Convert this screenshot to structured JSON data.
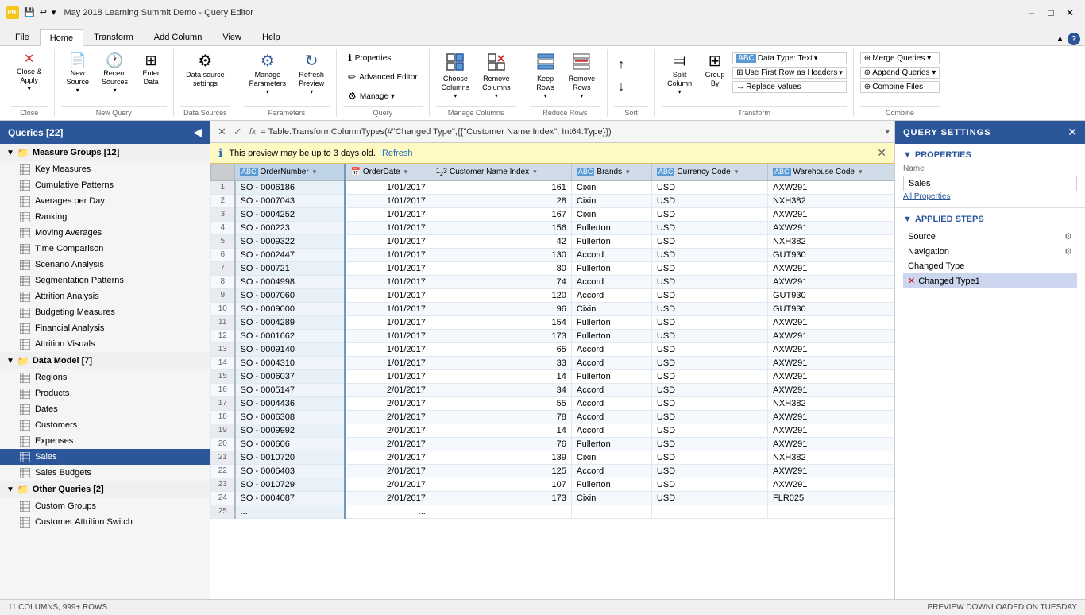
{
  "titleBar": {
    "icon": "PBI",
    "title": "May 2018 Learning Summit Demo - Query Editor",
    "minBtn": "–",
    "maxBtn": "□",
    "closeBtn": "✕"
  },
  "ribbonTabs": [
    "File",
    "Home",
    "Transform",
    "Add Column",
    "View",
    "Help"
  ],
  "activeTab": "Home",
  "ribbonGroups": {
    "close": {
      "label": "Close",
      "buttons": [
        {
          "label": "Close &\nApply",
          "icon": "✕"
        }
      ]
    },
    "newQuery": {
      "label": "New Query",
      "buttons": [
        {
          "label": "New\nSource",
          "icon": "📄"
        },
        {
          "label": "Recent\nSources",
          "icon": "🕐"
        },
        {
          "label": "Enter\nData",
          "icon": "⌨"
        }
      ]
    },
    "dataSources": {
      "label": "Data Sources",
      "buttons": [
        {
          "label": "Data source\nsettings",
          "icon": "⚙"
        }
      ]
    },
    "parameters": {
      "label": "Parameters",
      "buttons": [
        {
          "label": "Manage\nParameters",
          "icon": "⚙"
        },
        {
          "label": "Refresh\nPreview",
          "icon": "↻"
        }
      ]
    },
    "query": {
      "label": "Query",
      "buttons": [
        {
          "label": "Properties",
          "icon": "ℹ"
        },
        {
          "label": "Advanced Editor",
          "icon": "✏"
        },
        {
          "label": "Manage ▾",
          "icon": "⚙"
        }
      ]
    },
    "manageColumns": {
      "label": "Manage Columns",
      "buttons": [
        {
          "label": "Choose\nColumns",
          "icon": "⊞"
        },
        {
          "label": "Remove\nColumns",
          "icon": "⊟"
        }
      ]
    },
    "reduceRows": {
      "label": "Reduce Rows",
      "buttons": [
        {
          "label": "Keep\nRows",
          "icon": "⊡"
        },
        {
          "label": "Remove\nRows",
          "icon": "⊠"
        }
      ]
    },
    "sort": {
      "label": "Sort",
      "buttons": [
        {
          "label": "↑",
          "icon": "↑"
        },
        {
          "label": "↓",
          "icon": "↓"
        }
      ]
    },
    "transform": {
      "label": "Transform",
      "rows": [
        {
          "label": "Data Type: Text ▾",
          "icon": "ABC"
        },
        {
          "label": "Use First Row as Headers ▾",
          "icon": "⊞"
        },
        {
          "label": "Replace Values",
          "icon": "↔"
        }
      ],
      "buttons": [
        {
          "label": "Split\nColumn",
          "icon": "⫤"
        },
        {
          "label": "Group\nBy",
          "icon": "⊞"
        }
      ]
    },
    "combine": {
      "label": "Combine",
      "buttons": [
        {
          "label": "Merge Queries ▾",
          "icon": "⊕"
        },
        {
          "label": "Append Queries ▾",
          "icon": "⊕"
        },
        {
          "label": "Combine Files",
          "icon": "⊕"
        }
      ]
    }
  },
  "sidebar": {
    "title": "Queries [22]",
    "groups": [
      {
        "name": "Measure Groups [12]",
        "expanded": true,
        "items": [
          "Key Measures",
          "Cumulative Patterns",
          "Averages per Day",
          "Ranking",
          "Moving Averages",
          "Time Comparison",
          "Scenario Analysis",
          "Segmentation Patterns",
          "Attrition Analysis",
          "Budgeting Measures",
          "Financial Analysis",
          "Attrition Visuals"
        ]
      },
      {
        "name": "Data Model [7]",
        "expanded": true,
        "items": [
          "Regions",
          "Products",
          "Dates",
          "Customers",
          "Expenses",
          "Sales",
          "Sales Budgets"
        ]
      },
      {
        "name": "Other Queries [2]",
        "expanded": true,
        "items": [
          "Custom Groups",
          "Customer Attrition Switch"
        ]
      }
    ],
    "activeItem": "Sales"
  },
  "notification": {
    "icon": "ℹ",
    "text": "This preview may be up to 3 days old.",
    "refreshLabel": "Refresh"
  },
  "formulaBar": {
    "formula": "= Table.TransformColumnTypes(#\"Changed Type\",{{\"Customer Name Index\", Int64.Type}})"
  },
  "table": {
    "columns": [
      {
        "name": "OrderNumber",
        "type": "ABC",
        "isKey": true
      },
      {
        "name": "OrderDate",
        "type": "📅"
      },
      {
        "name": "Customer Name Index",
        "type": "123"
      },
      {
        "name": "Brands",
        "type": "ABC"
      },
      {
        "name": "Currency Code",
        "type": "ABC"
      },
      {
        "name": "Warehouse Code",
        "type": "ABC"
      }
    ],
    "rows": [
      [
        1,
        "SO - 0006186",
        "1/01/2017",
        161,
        "Cixin",
        "USD",
        "AXW291"
      ],
      [
        2,
        "SO - 0007043",
        "1/01/2017",
        28,
        "Cixin",
        "USD",
        "NXH382"
      ],
      [
        3,
        "SO - 0004252",
        "1/01/2017",
        167,
        "Cixin",
        "USD",
        "AXW291"
      ],
      [
        4,
        "SO - 000223",
        "1/01/2017",
        156,
        "Fullerton",
        "USD",
        "AXW291"
      ],
      [
        5,
        "SO - 0009322",
        "1/01/2017",
        42,
        "Fullerton",
        "USD",
        "NXH382"
      ],
      [
        6,
        "SO - 0002447",
        "1/01/2017",
        130,
        "Accord",
        "USD",
        "GUT930"
      ],
      [
        7,
        "SO - 000721",
        "1/01/2017",
        80,
        "Fullerton",
        "USD",
        "AXW291"
      ],
      [
        8,
        "SO - 0004998",
        "1/01/2017",
        74,
        "Accord",
        "USD",
        "AXW291"
      ],
      [
        9,
        "SO - 0007060",
        "1/01/2017",
        120,
        "Accord",
        "USD",
        "GUT930"
      ],
      [
        10,
        "SO - 0009000",
        "1/01/2017",
        96,
        "Cixin",
        "USD",
        "GUT930"
      ],
      [
        11,
        "SO - 0004289",
        "1/01/2017",
        154,
        "Fullerton",
        "USD",
        "AXW291"
      ],
      [
        12,
        "SO - 0001662",
        "1/01/2017",
        173,
        "Fullerton",
        "USD",
        "AXW291"
      ],
      [
        13,
        "SO - 0009140",
        "1/01/2017",
        65,
        "Accord",
        "USD",
        "AXW291"
      ],
      [
        14,
        "SO - 0004310",
        "1/01/2017",
        33,
        "Accord",
        "USD",
        "AXW291"
      ],
      [
        15,
        "SO - 0006037",
        "1/01/2017",
        14,
        "Fullerton",
        "USD",
        "AXW291"
      ],
      [
        16,
        "SO - 0005147",
        "2/01/2017",
        34,
        "Accord",
        "USD",
        "AXW291"
      ],
      [
        17,
        "SO - 0004436",
        "2/01/2017",
        55,
        "Accord",
        "USD",
        "NXH382"
      ],
      [
        18,
        "SO - 0006308",
        "2/01/2017",
        78,
        "Accord",
        "USD",
        "AXW291"
      ],
      [
        19,
        "SO - 0009992",
        "2/01/2017",
        14,
        "Accord",
        "USD",
        "AXW291"
      ],
      [
        20,
        "SO - 000606",
        "2/01/2017",
        76,
        "Fullerton",
        "USD",
        "AXW291"
      ],
      [
        21,
        "SO - 0010720",
        "2/01/2017",
        139,
        "Cixin",
        "USD",
        "NXH382"
      ],
      [
        22,
        "SO - 0006403",
        "2/01/2017",
        125,
        "Accord",
        "USD",
        "AXW291"
      ],
      [
        23,
        "SO - 0010729",
        "2/01/2017",
        107,
        "Fullerton",
        "USD",
        "AXW291"
      ],
      [
        24,
        "SO - 0004087",
        "2/01/2017",
        173,
        "Cixin",
        "USD",
        "FLR025"
      ],
      [
        25,
        "...",
        "...",
        "",
        "",
        "",
        ""
      ]
    ]
  },
  "querySettings": {
    "title": "QUERY SETTINGS",
    "properties": {
      "header": "PROPERTIES",
      "nameLabel": "Name",
      "nameValue": "Sales",
      "allPropertiesLink": "All Properties"
    },
    "appliedSteps": {
      "header": "APPLIED STEPS",
      "steps": [
        {
          "name": "Source",
          "hasGear": true,
          "isError": false
        },
        {
          "name": "Navigation",
          "hasGear": true,
          "isError": false
        },
        {
          "name": "Changed Type",
          "hasGear": false,
          "isError": false
        },
        {
          "name": "Changed Type1",
          "hasGear": false,
          "isError": true,
          "active": true
        }
      ]
    }
  },
  "statusBar": {
    "rowsInfo": "11 COLUMNS, 999+ ROWS",
    "previewInfo": "PREVIEW DOWNLOADED ON TUESDAY"
  }
}
